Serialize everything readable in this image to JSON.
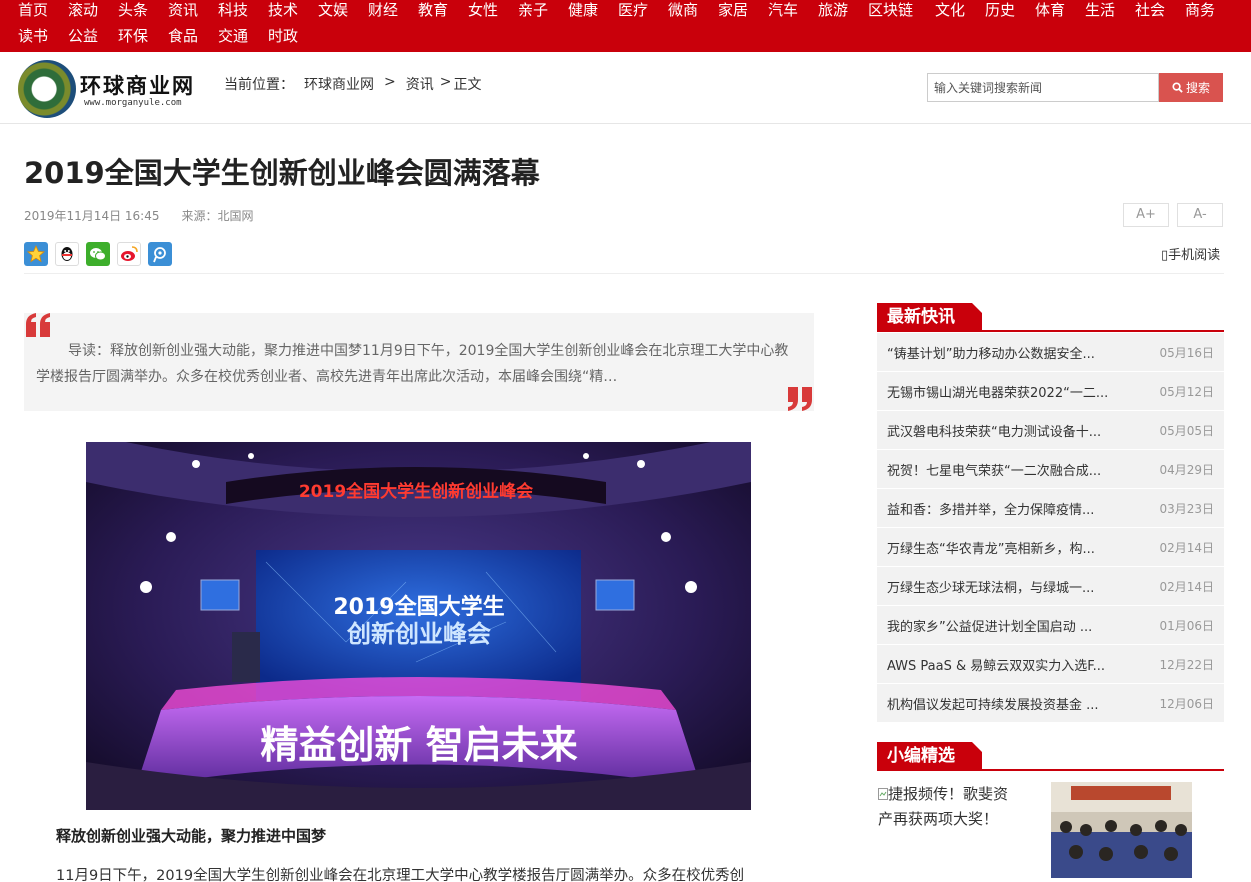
{
  "nav": {
    "row1": [
      "首页",
      "滚动",
      "头条",
      "资讯",
      "科技",
      "技术",
      "文娱",
      "财经",
      "教育",
      "女性",
      "亲子",
      "健康",
      "医疗",
      "微商",
      "家居",
      "汽车",
      "旅游",
      "区块链",
      "文化",
      "历史",
      "体育",
      "生活",
      "社会",
      "商务"
    ],
    "row2": [
      "读书",
      "公益",
      "环保",
      "食品",
      "交通",
      "时政"
    ]
  },
  "logo": {
    "title": "环球商业网",
    "url": "www.morganyule.com"
  },
  "breadcrumb": {
    "label": "当前位置：",
    "home": "环球商业网",
    "sep1": ">",
    "section": "资讯",
    "sep2": ">",
    "current": "正文"
  },
  "search": {
    "placeholder": "输入关键词搜索新闻",
    "button": "搜索"
  },
  "article": {
    "title": "2019全国大学生创新创业峰会圆满落幕",
    "date": "2019年11月14日 16:45",
    "source": "来源：北国网",
    "font_larger": "A+",
    "font_smaller": "A-",
    "mobile_read": "▯手机阅读",
    "summary": "导读：释放创新创业强大动能，聚力推进中国梦11月9日下午，2019全国大学生创新创业峰会在北京理工大学中心教学楼报告厅圆满举办。众多在校优秀创业者、高校先进青年出席此次活动，本届峰会围绕“精…",
    "photo": {
      "banner": "2019全国大学生创新创业峰会",
      "screen_line1": "2019全国大学生",
      "screen_line2": "创新创业峰会",
      "stage_slogan": "精益创新  智启未来"
    },
    "subheading": "释放创新创业强大动能，聚力推进中国梦",
    "paragraph": "11月9日下午，2019全国大学生创新创业峰会在北京理工大学中心教学楼报告厅圆满举办。众多在校优秀创"
  },
  "sidebar": {
    "latest_title": "最新快讯",
    "latest": [
      {
        "title": "“铸基计划”助力移动办公数据安全...",
        "date": "05月16日"
      },
      {
        "title": "无锡市锡山湖光电器荣获2022“一二...",
        "date": "05月12日"
      },
      {
        "title": "武汉磐电科技荣获“电力测试设备十...",
        "date": "05月05日"
      },
      {
        "title": "祝贺！七星电气荣获“一二次融合成...",
        "date": "04月29日"
      },
      {
        "title": "益和香：多措并举，全力保障疫情...",
        "date": "03月23日"
      },
      {
        "title": "万绿生态“华农青龙”亮相新乡，构...",
        "date": "02月14日"
      },
      {
        "title": "万绿生态少球无球法桐，与绿城一...",
        "date": "02月14日"
      },
      {
        "title": "我的家乡”公益促进计划全国启动 ...",
        "date": "01月06日"
      },
      {
        "title": "AWS PaaS & 易鲸云双双实力入选F...",
        "date": "12月22日"
      },
      {
        "title": "机构倡议发起可持续发展投资基金 ...",
        "date": "12月06日"
      }
    ],
    "picks_title": "小编精选",
    "pick": {
      "text": "捷报频传！歌斐资产再获两项大奖！"
    }
  }
}
